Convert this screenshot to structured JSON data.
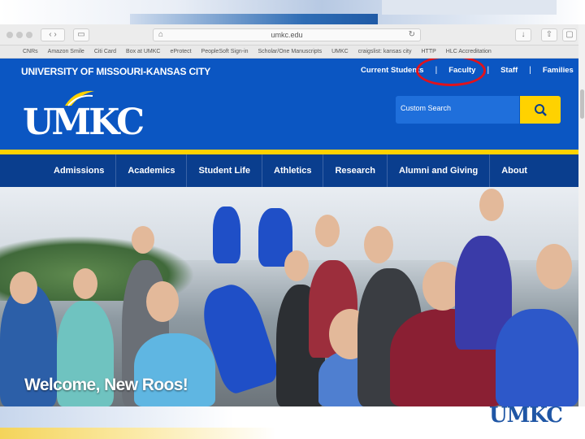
{
  "browser": {
    "url": "umkc.edu",
    "bookmarks": [
      "CNRs",
      "Amazon Smile",
      "Citi Card",
      "Box at UMKC",
      "eProtect",
      "PeopleSoft Sign-in",
      "Scholar/One Manuscripts",
      "UMKC",
      "craigslist: kansas city",
      "HTTP",
      "HLC Accreditation"
    ]
  },
  "site": {
    "university_name": "UNIVERSITY OF MISSOURI-KANSAS CITY",
    "top_links": [
      "Current Students",
      "Faculty",
      "Staff",
      "Families"
    ],
    "logo_text": "UMKC",
    "search_placeholder": "Custom Search",
    "nav": [
      "Admissions",
      "Academics",
      "Student Life",
      "Athletics",
      "Research",
      "Alumni and Giving",
      "About"
    ],
    "hero_caption": "Welcome, New Roos!",
    "colors": {
      "primary": "#0b56c2",
      "nav": "#0a3e8e",
      "accent": "#ffd200",
      "highlight": "#e0121c"
    }
  },
  "slide": {
    "footer_logo": "UMKC"
  }
}
